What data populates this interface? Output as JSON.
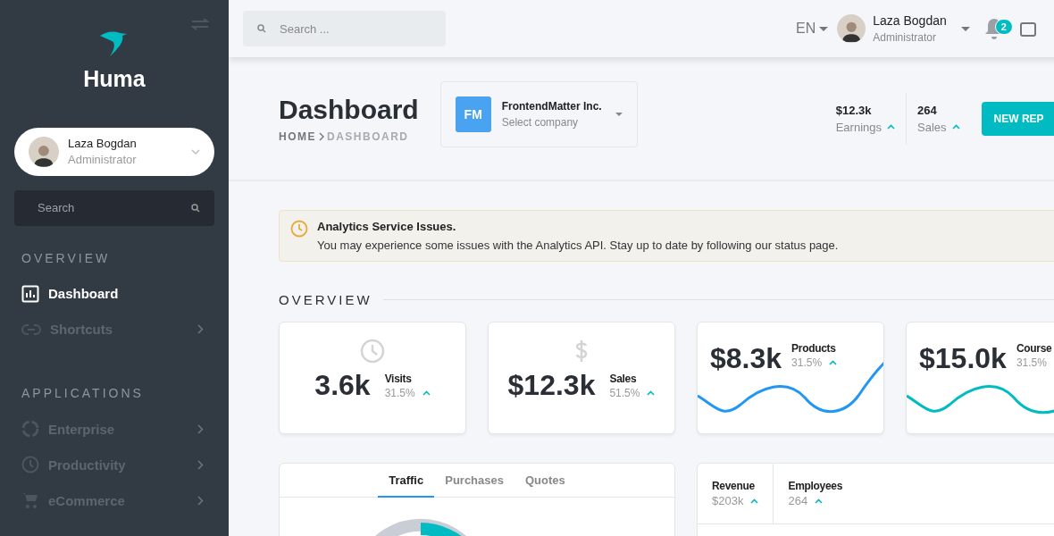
{
  "sidebar": {
    "brand": "Huma",
    "user": {
      "name": "Laza Bogdan",
      "role": "Administrator"
    },
    "search": {
      "placeholder": "Search"
    },
    "sections": [
      {
        "title": "OVERVIEW",
        "items": [
          {
            "label": "Dashboard",
            "selected": true,
            "has_children": false
          },
          {
            "label": "Shortcuts",
            "selected": false,
            "has_children": true
          }
        ]
      },
      {
        "title": "APPLICATIONS",
        "items": [
          {
            "label": "Enterprise",
            "selected": false,
            "has_children": true
          },
          {
            "label": "Productivity",
            "selected": false,
            "has_children": true
          },
          {
            "label": "eCommerce",
            "selected": false,
            "has_children": true
          }
        ]
      }
    ]
  },
  "topbar": {
    "search": {
      "placeholder": "Search ..."
    },
    "language": "EN",
    "user": {
      "name": "Laza Bogdan",
      "role": "Administrator"
    },
    "notifications": "2"
  },
  "header": {
    "title": "Dashboard",
    "breadcrumb": [
      "HOME",
      "DASHBOARD"
    ],
    "company": {
      "initials": "FM",
      "name": "FrontendMatter Inc.",
      "hint": "Select company"
    },
    "stats": [
      {
        "value": "$12.3k",
        "label": "Earnings"
      },
      {
        "value": "264",
        "label": "Sales"
      }
    ],
    "button": "NEW REP"
  },
  "alert": {
    "title": "Analytics Service Issues.",
    "message": "You may experience some issues with the Analytics API. Stay up to date by following our status page."
  },
  "overview": {
    "title": "OVERVIEW",
    "cards": [
      {
        "kind": "icon",
        "value": "3.6k",
        "label": "Visits",
        "change": "31.5%"
      },
      {
        "kind": "icon",
        "value": "$12.3k",
        "label": "Sales",
        "change": "51.5%"
      },
      {
        "kind": "sparkline",
        "value": "$8.3k",
        "label": "Products",
        "change": "31.5%",
        "color": "#2196f3"
      },
      {
        "kind": "sparkline",
        "value": "$15.0k",
        "label": "Course",
        "change": "31.5%",
        "color": "#00bcc2"
      }
    ]
  },
  "traffic": {
    "tabs": [
      {
        "label": "Traffic",
        "selected": true
      },
      {
        "label": "Purchases",
        "selected": false
      },
      {
        "label": "Quotes",
        "selected": false
      }
    ]
  },
  "team": {
    "stats": [
      {
        "label": "Revenue",
        "value": "$203k"
      },
      {
        "label": "Employees",
        "value": "264"
      }
    ]
  }
}
